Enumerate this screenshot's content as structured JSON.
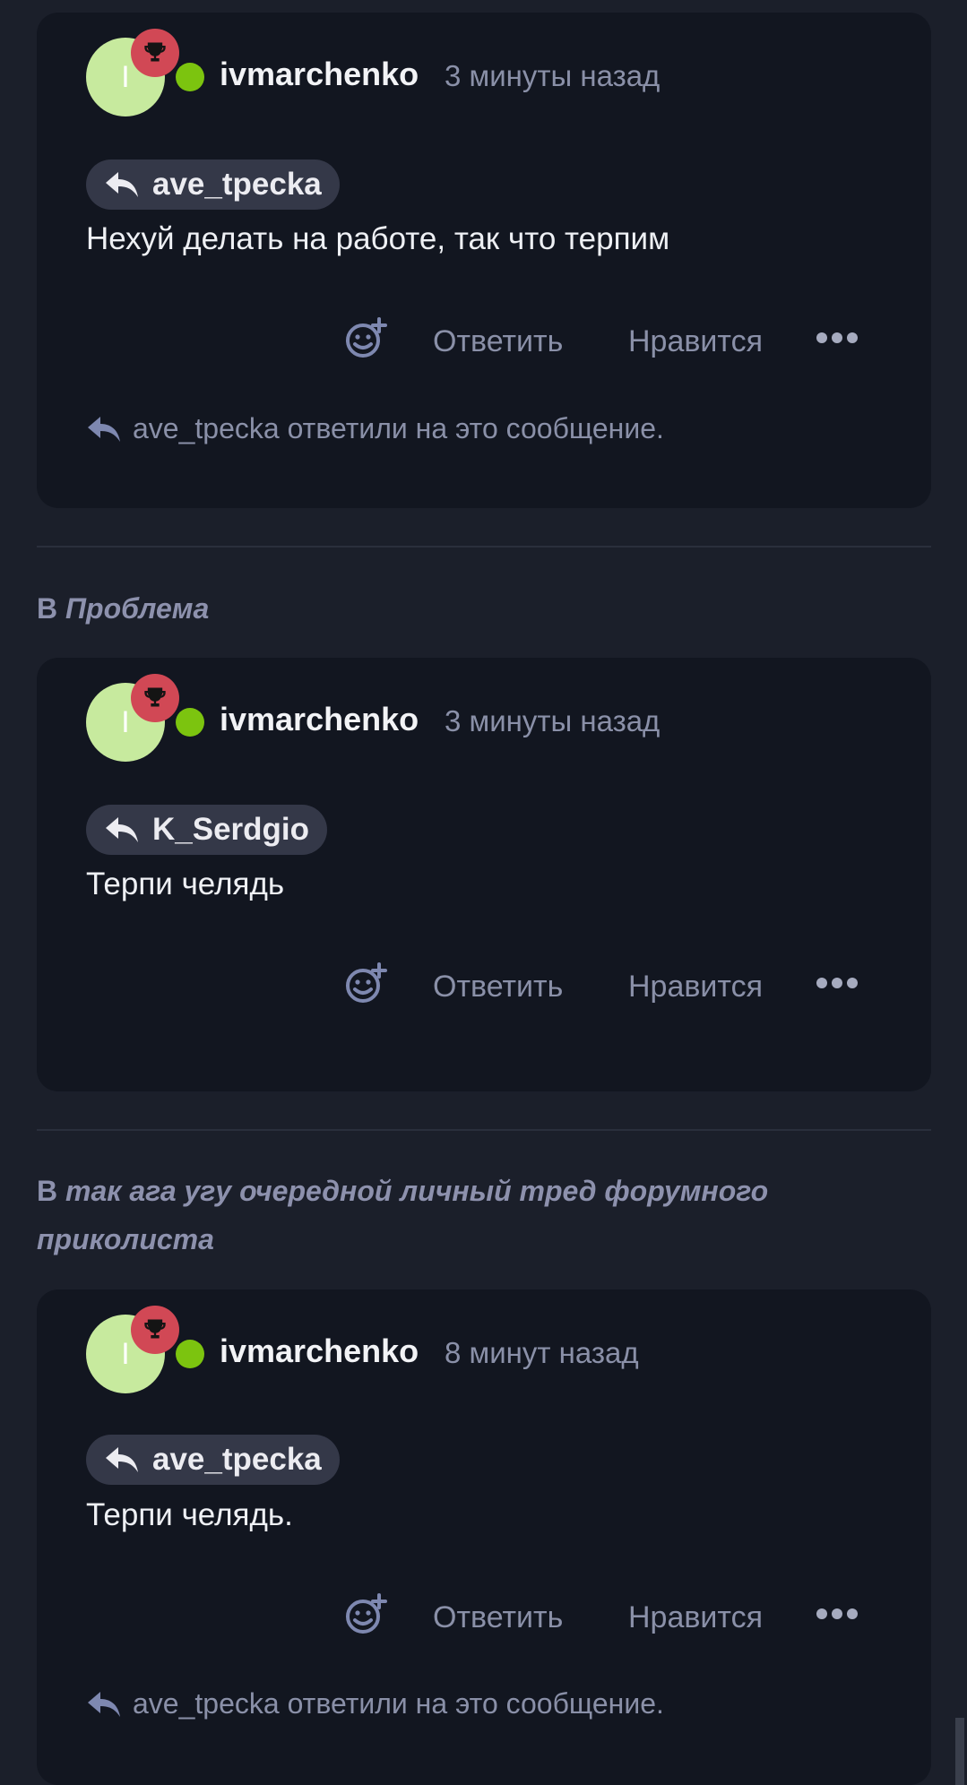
{
  "posts": [
    {
      "author": "ivmarchenko",
      "avatar_letter": "I",
      "time": "3 минуты назад",
      "reply_to": "ave_tpecka",
      "text": "Нехуй делать на работе, так что терпим",
      "reply_label": "Ответить",
      "like_label": "Нравится",
      "replied_note": "ave_tpecka ответили на это сообщение."
    },
    {
      "topic_prefix": "В",
      "topic": "Проблема",
      "author": "ivmarchenko",
      "avatar_letter": "I",
      "time": "3 минуты назад",
      "reply_to": "K_Serdgio",
      "text": "Терпи челядь",
      "reply_label": "Ответить",
      "like_label": "Нравится"
    },
    {
      "topic_prefix": "В",
      "topic": "так ага угу очередной личный тред форумного приколиста",
      "author": "ivmarchenko",
      "avatar_letter": "I",
      "time": "8 минут назад",
      "reply_to": "ave_tpecka",
      "text": "Терпи челядь.",
      "reply_label": "Ответить",
      "like_label": "Нравится",
      "replied_note": "ave_tpecka ответили на это сообщение."
    }
  ],
  "colors": {
    "page_bg": "#1b1f2a",
    "card_bg": "#121620",
    "avatar_bg": "#c7ea9e",
    "badge_bg": "#d14855",
    "online": "#7cc40f",
    "muted_text": "#8a90a8",
    "topic_text": "#8d91ad",
    "pill_bg": "#343848"
  },
  "icons": {
    "badge": "trophy-icon",
    "reply": "reply-arrow-icon",
    "react": "add-reaction-icon",
    "more": "more-dots-icon"
  }
}
